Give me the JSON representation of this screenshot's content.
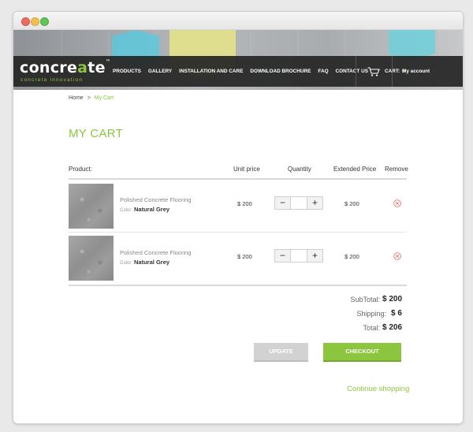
{
  "header": {
    "logo": {
      "text_start": "concre",
      "text_accent": "a",
      "text_end": "te",
      "mark": "™",
      "tagline": "concrete innovation"
    },
    "nav": [
      "PRODUCTS",
      "GALLERY",
      "INSTALLATION AND CARE",
      "DOWNLOAD BROCHURE",
      "FAQ",
      "CONTACT US"
    ],
    "cart_label": "CART:",
    "cart_count": "0",
    "account": "My account"
  },
  "breadcrumb": {
    "home": "Home",
    "separator": ">",
    "current": "My Cart"
  },
  "page_title": "MY CART",
  "table": {
    "headers": {
      "product": "Product:",
      "unit_price": "Unit price",
      "quantity": "Quantity",
      "extended_price": "Extended Price",
      "remove": "Remove"
    },
    "rows": [
      {
        "name": "Polished Concrete Flooring",
        "color_label": "Color:",
        "color_value": "Natural Grey",
        "unit_price": "$ 200",
        "quantity": "",
        "extended_price": "$ 200"
      },
      {
        "name": "Polished Concrete Flooring",
        "color_label": "Color:",
        "color_value": "Natural Grey",
        "unit_price": "$ 200",
        "quantity": "",
        "extended_price": "$ 200"
      }
    ]
  },
  "stepper": {
    "minus": "−",
    "plus": "+"
  },
  "totals": {
    "subtotal_label": "SubTotal:",
    "subtotal_value": "$ 200",
    "shipping_label": "Shipping:",
    "shipping_value": "$ 6",
    "total_label": "Total:",
    "total_value": "$ 206"
  },
  "buttons": {
    "update": "UPDATE",
    "checkout": "CHECKOUT"
  },
  "continue_shopping": "Continue shopping",
  "colors": {
    "accent": "#8cc63f",
    "nav_bg": "#262626",
    "remove": "#e57373"
  }
}
